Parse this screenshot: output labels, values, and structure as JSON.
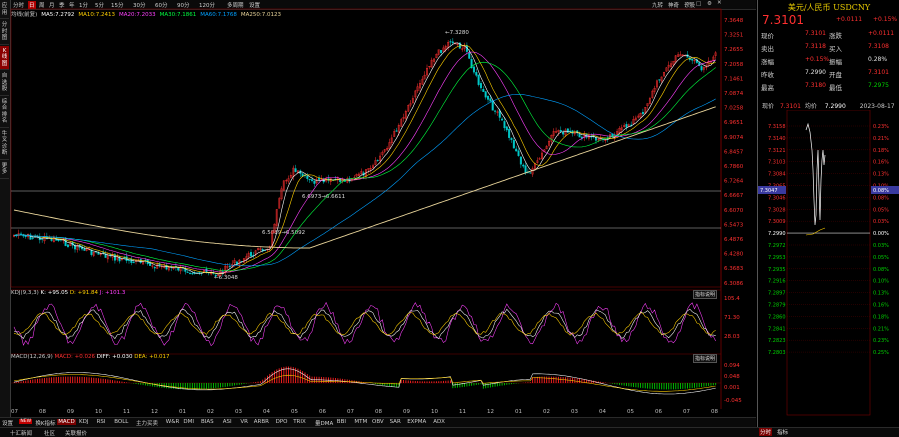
{
  "colors": {
    "up": "#ff3030",
    "down": "#00c8c8",
    "ma5": "#ffffff",
    "ma10": "#ffd000",
    "ma20": "#ff40ff",
    "ma30": "#00ff40",
    "ma60": "#00a0ff",
    "ma250": "#e8d49a",
    "k": "#ffffff",
    "d": "#ffd000",
    "j": "#ff40ff",
    "macdpos": "#ff2020",
    "macdneg": "#00c800",
    "accent": "#8a0000",
    "title": "#e6c800"
  },
  "left_toolbar": [
    "应用",
    "分时图",
    "K线图",
    "自选股",
    "综合排名",
    "牛叉诊断",
    "更多"
  ],
  "period_toolbar": {
    "items": [
      "分时",
      "日",
      "周",
      "月",
      "季",
      "年",
      "1分",
      "5分",
      "15分",
      "30分",
      "60分",
      "90分",
      "120分",
      "多周期",
      "设置"
    ],
    "active_index": 1,
    "right": [
      "九转",
      "神奇",
      "诊股"
    ]
  },
  "indicators": {
    "ma": [
      {
        "label": "均线(前复)",
        "value": ""
      },
      {
        "label": "MA5:",
        "value": "7.2792"
      },
      {
        "label": "MA10:",
        "value": "7.2413"
      },
      {
        "label": "MA20:",
        "value": "7.2033"
      },
      {
        "label": "MA30:",
        "value": "7.1861"
      },
      {
        "label": "MA60:",
        "value": "7.1768"
      },
      {
        "label": "MA250:",
        "value": "7.0123"
      }
    ],
    "kdj": {
      "name": "KDJ(9,3,3)",
      "k": "K: +95.05",
      "d": "D: +91.84",
      "j": "J: +101.3"
    },
    "macd": {
      "name": "MACD(12,26,9)",
      "macd": "MACD: +0.026",
      "diff": "DIFF: +0.030",
      "dea": "DEA: +0.017"
    },
    "hint_btn": "指标说明"
  },
  "price_axis": [
    "7.3648",
    "7.3251",
    "7.2655",
    "7.2058",
    "7.1461",
    "7.0874",
    "7.0258",
    "6.9651",
    "6.9074",
    "6.8457",
    "6.7860",
    "6.7264",
    "6.6667",
    "6.6070",
    "6.5473",
    "6.4876",
    "6.4280",
    "6.3683",
    "6.3086"
  ],
  "kdj_axis": [
    "105.4",
    "71.30",
    "28.03"
  ],
  "macd_axis": [
    "0.094",
    "0.048",
    "0.001",
    "-0.045"
  ],
  "annotations": {
    "high": "7.3280",
    "low": "6.3048",
    "level1": "6.6973→6.6611",
    "level2": "6.5089→6.5092"
  },
  "x_axis": [
    "07",
    "08",
    "09",
    "10",
    "11",
    "12",
    "01",
    "02",
    "03",
    "04",
    "05",
    "06",
    "07",
    "08",
    "09",
    "10",
    "11",
    "12",
    "01",
    "02",
    "03",
    "04",
    "05",
    "06",
    "07",
    "08"
  ],
  "indicator_bar": {
    "items": [
      "设置",
      "换K指标",
      "MACD",
      "KDJ",
      "RSI",
      "BOLL",
      "主力买卖",
      "W&R",
      "DMI",
      "BIAS",
      "ASI",
      "VR",
      "ARBR",
      "DPO",
      "TRIX",
      "量DMA",
      "BBI",
      "MTM",
      "OBV",
      "SAR",
      "EXPMA",
      "ADX"
    ],
    "active_index": 2,
    "badge": "NEW"
  },
  "bottom_bar": [
    "十汇新闻",
    "社区",
    "关联报价"
  ],
  "quote": {
    "title": "美元/人民币 USDCNY",
    "price": "7.3101",
    "change": "+0.0111",
    "pct": "+0.15%",
    "rows": [
      {
        "l1": "现价",
        "v1": "7.3101",
        "l2": "涨跌",
        "v2": "+0.0111",
        "c1": "up",
        "c2": "up"
      },
      {
        "l1": "卖出",
        "v1": "7.3118",
        "l2": "买入",
        "v2": "7.3108",
        "c1": "up",
        "c2": "up"
      },
      {
        "l1": "涨幅",
        "v1": "+0.15%",
        "l2": "振幅",
        "v2": "0.28%",
        "c1": "up",
        "c2": "plain"
      },
      {
        "l1": "昨收",
        "v1": "7.2990",
        "l2": "开盘",
        "v2": "7.3101",
        "c1": "plain",
        "c2": "up"
      },
      {
        "l1": "最高",
        "v1": "7.3180",
        "l2": "最低",
        "v2": "7.2975",
        "c1": "up",
        "c2": "down"
      }
    ]
  },
  "minute": {
    "label": "现价",
    "price": "7.3101",
    "avg_label": "均价",
    "avg": "7.2990",
    "date": "2023-08-17",
    "left_axis": [
      "7.3158",
      "7.3140",
      "7.3121",
      "7.3103",
      "7.3084",
      "7.3065",
      "7.3046",
      "7.3028",
      "7.3009",
      "7.2990",
      "7.2972",
      "7.2953",
      "7.2935",
      "7.2916",
      "7.2897",
      "7.2879",
      "7.2860",
      "7.2841",
      "7.2823",
      "7.2803"
    ],
    "right_axis": [
      "0.23%",
      "0.21%",
      "0.18%",
      "0.16%",
      "0.13%",
      "0.10%",
      "0.08%",
      "0.05%",
      "0.03%",
      "0.00%",
      "0.03%",
      "0.05%",
      "0.08%",
      "0.10%",
      "0.13%",
      "0.16%",
      "0.18%",
      "0.21%",
      "0.23%",
      "0.25%"
    ],
    "highlight": "7.3047",
    "highlight_pct": "0.08%"
  },
  "window_tabs": {
    "items": [
      "分时",
      "指标"
    ],
    "active_index": 0
  }
}
